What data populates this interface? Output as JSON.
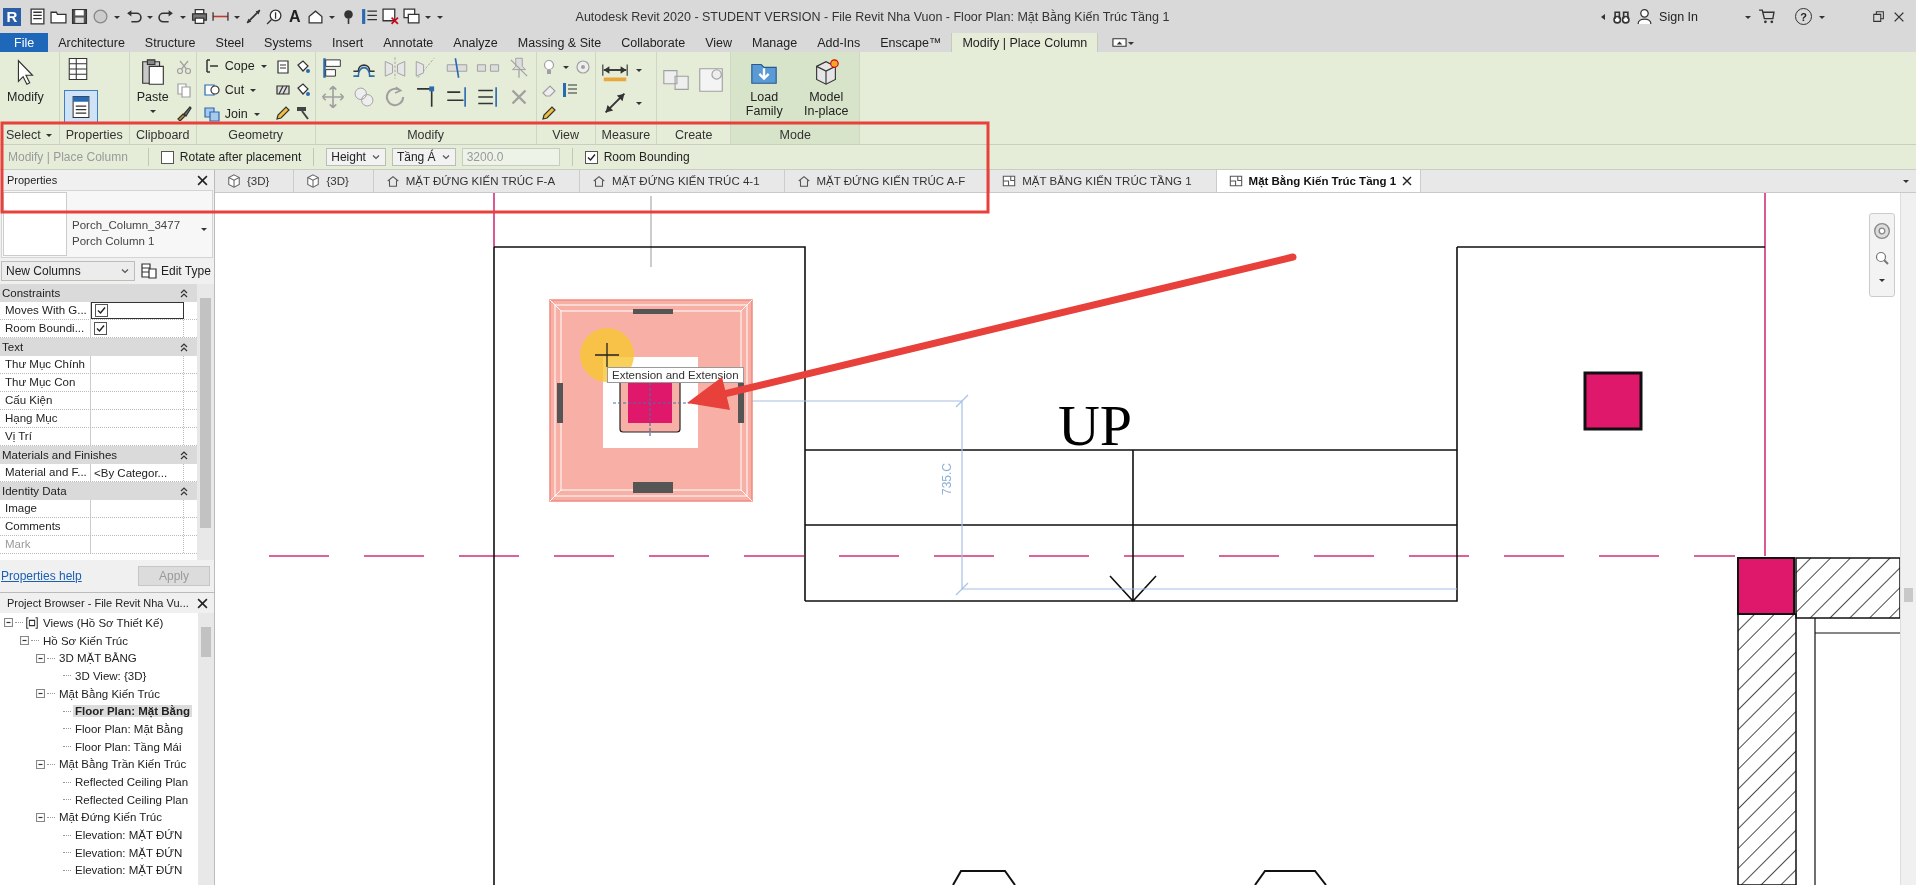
{
  "title_bar": {
    "app_logo": "R",
    "text_tool_glyph": "A",
    "title": "Autodesk Revit 2020 - STUDENT VERSION - File Revit Nha Vuon - Floor Plan: Mặt Bằng Kiến Trúc Tầng 1",
    "sign_in": "Sign In",
    "help_glyph": "?"
  },
  "menu_tabs": [
    {
      "label": "File",
      "kind": "file",
      "selected": false
    },
    {
      "label": "Architecture",
      "kind": "tab",
      "selected": false
    },
    {
      "label": "Structure",
      "kind": "tab",
      "selected": false
    },
    {
      "label": "Steel",
      "kind": "tab",
      "selected": false
    },
    {
      "label": "Systems",
      "kind": "tab",
      "selected": false
    },
    {
      "label": "Insert",
      "kind": "tab",
      "selected": false
    },
    {
      "label": "Annotate",
      "kind": "tab",
      "selected": false
    },
    {
      "label": "Analyze",
      "kind": "tab",
      "selected": false
    },
    {
      "label": "Massing & Site",
      "kind": "tab",
      "selected": false
    },
    {
      "label": "Collaborate",
      "kind": "tab",
      "selected": false
    },
    {
      "label": "View",
      "kind": "tab",
      "selected": false
    },
    {
      "label": "Manage",
      "kind": "tab",
      "selected": false
    },
    {
      "label": "Add-Ins",
      "kind": "tab",
      "selected": false
    },
    {
      "label": "Enscape™",
      "kind": "tab",
      "selected": false
    },
    {
      "label": "Modify | Place Column",
      "kind": "tab",
      "selected": true
    }
  ],
  "ribbon": {
    "panels": [
      {
        "kind": "select",
        "label": "Select",
        "tools": [
          {
            "label": "Modify"
          }
        ]
      },
      {
        "kind": "properties",
        "label": "Properties",
        "active": true
      },
      {
        "kind": "clipboard",
        "label": "Clipboard",
        "tools": [
          {
            "label": "Paste"
          }
        ]
      },
      {
        "kind": "geometry",
        "label": "Geometry",
        "tools": [
          {
            "label": "Cope"
          },
          {
            "label": "Cut"
          },
          {
            "label": "Join"
          }
        ]
      },
      {
        "kind": "modify",
        "label": "Modify"
      },
      {
        "kind": "view",
        "label": "View"
      },
      {
        "kind": "measure",
        "label": "Measure"
      },
      {
        "kind": "create",
        "label": "Create"
      },
      {
        "kind": "mode",
        "label": "Mode",
        "tools": [
          {
            "label": "Load Family"
          },
          {
            "label": "Model In-place"
          }
        ]
      }
    ]
  },
  "options_bar": {
    "mode_label": "Modify | Place Column",
    "rotate_after_placement": {
      "label": "Rotate after placement",
      "checked": false
    },
    "depth_mode": "Height",
    "top_level": "Tầng Á",
    "height_value": "3200.0",
    "room_bounding": {
      "label": "Room Bounding",
      "checked": true
    }
  },
  "view_tabs": [
    {
      "label": "{3D}",
      "kind": "cube",
      "selected": false
    },
    {
      "label": "{3D}",
      "kind": "cube",
      "selected": false
    },
    {
      "label": "MẶT ĐỨNG KIẾN TRÚC F-A",
      "kind": "house",
      "selected": false
    },
    {
      "label": "MẶT ĐỨNG KIẾN TRÚC 4-1",
      "kind": "house",
      "selected": false
    },
    {
      "label": "MẶT ĐỨNG KIẾN TRÚC A-F",
      "kind": "house",
      "selected": false
    },
    {
      "label": "MẶT BẰNG KIẾN TRÚC TẦNG 1",
      "kind": "sheet",
      "selected": false
    },
    {
      "label": "Mặt Bằng Kiến Trúc Tầng 1",
      "kind": "sheet",
      "selected": true
    }
  ],
  "properties": {
    "title": "Properties",
    "type_family": "Porch_Column_3477",
    "type_name": "Porch Column 1",
    "filter": "New Columns",
    "edit_type": "Edit Type",
    "groups": [
      {
        "label": "Constraints",
        "rows": [
          {
            "name": "Moves With G...",
            "kind": "checkbox",
            "checked": true,
            "disabled": false
          },
          {
            "name": "Room Boundi...",
            "kind": "checkbox",
            "checked": true,
            "disabled": false
          }
        ]
      },
      {
        "label": "Text",
        "rows": [
          {
            "name": "Thư Mục Chính",
            "kind": "text",
            "disabled": false
          },
          {
            "name": "Thư Mục Con",
            "kind": "text",
            "disabled": false
          },
          {
            "name": "Cấu Kiện",
            "kind": "text",
            "disabled": false
          },
          {
            "name": "Hạng Mục",
            "kind": "text",
            "disabled": false
          },
          {
            "name": "Vị Trí",
            "kind": "text",
            "disabled": false
          }
        ]
      },
      {
        "label": "Materials and Finishes",
        "rows": [
          {
            "name": "Material and F...",
            "kind": "text",
            "value": "<By Categor...",
            "disabled": false
          }
        ]
      },
      {
        "label": "Identity Data",
        "rows": [
          {
            "name": "Image",
            "kind": "text",
            "disabled": false
          },
          {
            "name": "Comments",
            "kind": "text",
            "disabled": false
          },
          {
            "name": "Mark",
            "kind": "text",
            "disabled": true
          }
        ]
      }
    ],
    "help_link": "Properties help",
    "apply": {
      "label": "Apply",
      "disabled": true
    }
  },
  "project_browser": {
    "title": "Project Browser - File Revit Nha Vu...",
    "tree": [
      {
        "label": "Views (Hồ Sơ Thiết Kế)",
        "expanded": true,
        "selected": false,
        "children": [
          {
            "label": "Hồ Sơ Kiến Trúc",
            "expanded": true,
            "selected": false,
            "children": [
              {
                "label": "3D MẶT BẰNG",
                "expanded": true,
                "selected": false,
                "children": [
                  {
                    "label": "3D View: {3D}",
                    "selected": false
                  }
                ]
              },
              {
                "label": "Mặt Bằng Kiến Trúc",
                "expanded": true,
                "selected": false,
                "children": [
                  {
                    "label": "Floor Plan: Mặt Bằng",
                    "selected": true
                  },
                  {
                    "label": "Floor Plan: Mặt Bằng",
                    "selected": false
                  },
                  {
                    "label": "Floor Plan: Tầng Mái",
                    "selected": false
                  }
                ]
              },
              {
                "label": "Mặt Bằng Trần Kiến Trúc",
                "expanded": true,
                "selected": false,
                "children": [
                  {
                    "label": "Reflected Ceiling Plan",
                    "selected": false
                  },
                  {
                    "label": "Reflected Ceiling Plan",
                    "selected": false
                  }
                ]
              },
              {
                "label": "Mặt Đứng Kiến Trúc",
                "expanded": true,
                "selected": false,
                "children": [
                  {
                    "label": "Elevation: MẶT ĐỨN",
                    "selected": false
                  },
                  {
                    "label": "Elevation: MẶT ĐỨN",
                    "selected": false
                  },
                  {
                    "label": "Elevation: MẶT ĐỨN",
                    "selected": false
                  }
                ]
              }
            ]
          }
        ]
      }
    ]
  },
  "canvas": {
    "stair_label": "UP",
    "dimension": "735.C",
    "tooltip": "Extension and Extension"
  }
}
